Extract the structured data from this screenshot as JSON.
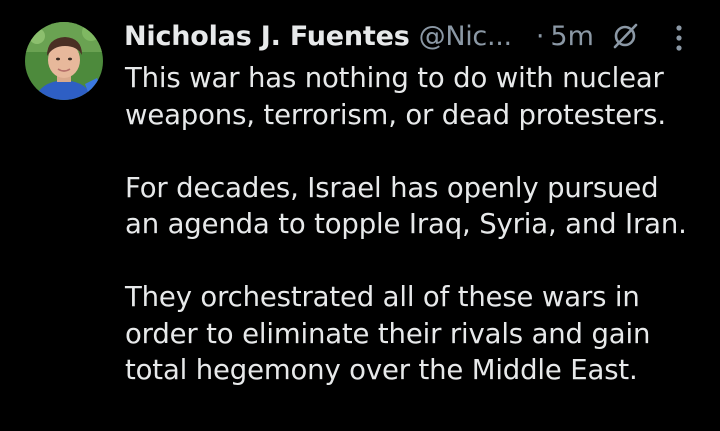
{
  "tweet": {
    "author_name": "Nicholas J. Fuentes",
    "handle": "@Nic...",
    "separator": "·",
    "time": "5m",
    "avatar_icon": "profile-photo",
    "grok_icon": "slashed-circle-icon",
    "more_icon": "vertical-ellipsis-icon",
    "lines": [
      "This war has nothing to do with nuclear",
      "weapons, terrorism, or dead protesters.",
      "For decades, Israel has openly pursued",
      "an agenda to topple Iraq, Syria, and Iran.",
      "They orchestrated all of these wars in",
      "order to eliminate their rivals and gain",
      "total hegemony over the Middle East."
    ]
  },
  "colors": {
    "background": "#000000",
    "primary_text": "#e7e9ea",
    "secondary_text": "#8b98a5"
  }
}
